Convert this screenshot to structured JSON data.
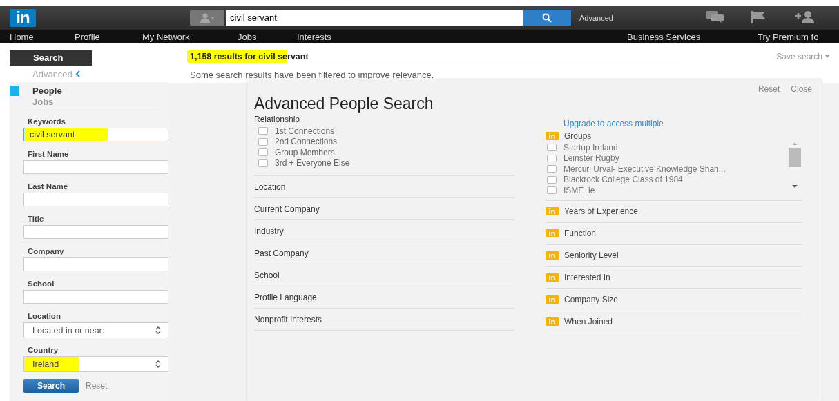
{
  "header": {
    "logo": "in",
    "search": {
      "value": "civil servant"
    },
    "advanced_link": "Advanced"
  },
  "nav": {
    "items": [
      {
        "label": "Home"
      },
      {
        "label": "Profile"
      },
      {
        "label": "My Network"
      },
      {
        "label": "Jobs"
      },
      {
        "label": "Interests"
      }
    ],
    "right_items": [
      {
        "label": "Business Services"
      },
      {
        "label": "Try Premium fo"
      }
    ]
  },
  "sidebar": {
    "tab": "Search",
    "advanced": "Advanced",
    "categories": [
      {
        "label": "People",
        "selected": true
      },
      {
        "label": "Jobs",
        "selected": false
      }
    ],
    "fields": [
      {
        "kind": "text",
        "label": "Keywords",
        "value": "civil servant",
        "highlighted": true
      },
      {
        "kind": "text",
        "label": "First Name",
        "highlighted": false
      },
      {
        "kind": "text",
        "label": "Last Name",
        "highlighted": false
      },
      {
        "kind": "text",
        "label": "Title",
        "highlighted": false
      },
      {
        "kind": "text",
        "label": "Company",
        "highlighted": false
      },
      {
        "kind": "text",
        "label": "School",
        "highlighted": false
      },
      {
        "kind": "select",
        "label": "Location",
        "value": "Located in or near:",
        "highlighted": false
      },
      {
        "kind": "select",
        "label": "Country",
        "value": "Ireland",
        "highlighted": true
      }
    ],
    "search_button": "Search",
    "reset_link": "Reset"
  },
  "results": {
    "heading": "1,158 results for civil servant",
    "highlighted": true,
    "save_search": "Save search",
    "notice": "Some search results have been filtered to improve relevance."
  },
  "dialog": {
    "title": "Advanced People Search",
    "actions": [
      "Reset",
      "Close"
    ],
    "relationship": {
      "label": "Relationship",
      "options": [
        {
          "label": "1st Connections",
          "checked": false
        },
        {
          "label": "2nd Connections",
          "checked": false
        },
        {
          "label": "Group Members",
          "checked": false
        },
        {
          "label": "3rd + Everyone Else",
          "checked": false
        }
      ]
    },
    "facets": [
      {
        "label": "Location"
      },
      {
        "label": "Current Company"
      },
      {
        "label": "Industry"
      },
      {
        "label": "Past Company"
      },
      {
        "label": "School"
      },
      {
        "label": "Profile Language"
      },
      {
        "label": "Nonprofit Interests"
      }
    ],
    "upgrade_link": "Upgrade to access multiple",
    "premium_facets": [
      {
        "badge": "in",
        "label": "Groups",
        "options": [
          {
            "label": "Startup Ireland",
            "checked": false
          },
          {
            "label": "Leinster Rugby",
            "checked": false
          },
          {
            "label": "Mercuri Urval- Executive Knowledge Shari...",
            "checked": false
          },
          {
            "label": "Blackrock College Class of 1984",
            "checked": false
          },
          {
            "label": "ISME_ie",
            "checked": false
          }
        ]
      },
      {
        "badge": "in",
        "label": "Years of Experience"
      },
      {
        "badge": "in",
        "label": "Function"
      },
      {
        "badge": "in",
        "label": "Seniority Level"
      },
      {
        "badge": "in",
        "label": "Interested In"
      },
      {
        "badge": "in",
        "label": "Company Size"
      },
      {
        "badge": "in",
        "label": "When Joined"
      }
    ]
  }
}
